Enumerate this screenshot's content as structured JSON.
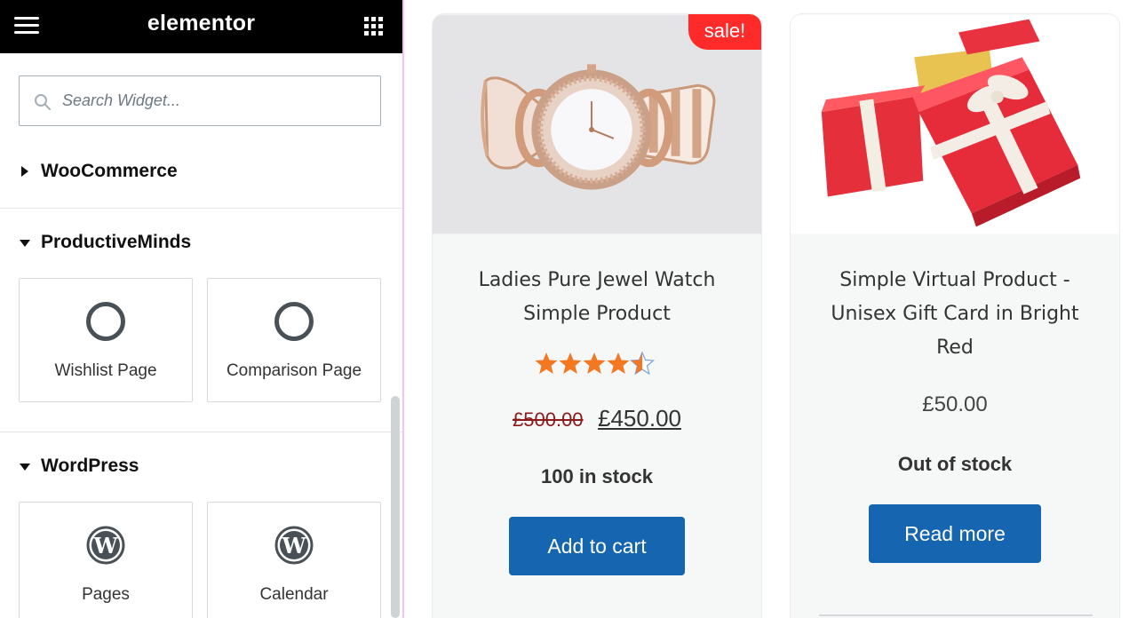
{
  "topbar": {
    "brand": "elementor",
    "menu_icon": "hamburger-menu-icon",
    "apps_icon": "apps-grid-icon"
  },
  "search": {
    "placeholder": "Search Widget...",
    "value": ""
  },
  "categories": [
    {
      "label": "WooCommerce",
      "expanded": false
    },
    {
      "label": "ProductiveMinds",
      "expanded": true,
      "widgets": [
        {
          "label": "Wishlist Page",
          "icon": "circle-icon"
        },
        {
          "label": "Comparison Page",
          "icon": "circle-icon"
        }
      ]
    },
    {
      "label": "WordPress",
      "expanded": true,
      "widgets": [
        {
          "label": "Pages",
          "icon": "wordpress-icon"
        },
        {
          "label": "Calendar",
          "icon": "wordpress-icon"
        }
      ]
    }
  ],
  "products": [
    {
      "badge": "sale!",
      "title_line1": "Ladies Pure Jewel Watch",
      "title_line2": "Simple Product",
      "rating": 4.5,
      "rating_max": 5,
      "old_price": "£500.00",
      "price": "£450.00",
      "stock": "100 in stock",
      "button": "Add to cart"
    },
    {
      "title_line1": "Simple Virtual Product -",
      "title_line2": "Unisex Gift Card in Bright",
      "title_line3": "Red",
      "price": "£50.00",
      "stock": "Out of stock",
      "button": "Read more"
    }
  ],
  "colors": {
    "accent": "#1565b0",
    "sale": "#ff2a2a",
    "star": "#f47721",
    "topbar": "#000000"
  }
}
